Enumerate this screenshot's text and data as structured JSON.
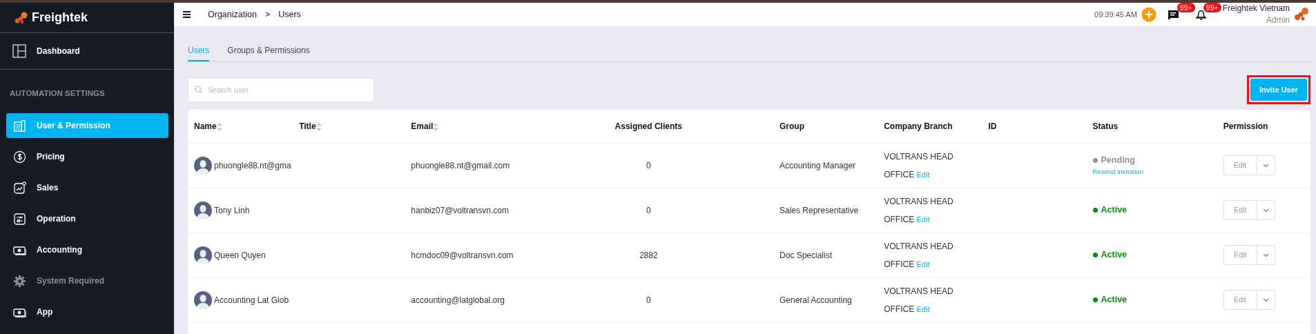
{
  "sidebar": {
    "brand": "Freightek",
    "top_item": {
      "label": "Dashboard"
    },
    "section": "AUTOMATION SETTINGS",
    "items": [
      {
        "label": "User & Permission",
        "selected": true,
        "disabled": false
      },
      {
        "label": "Pricing",
        "selected": false,
        "disabled": false
      },
      {
        "label": "Sales",
        "selected": false,
        "disabled": false
      },
      {
        "label": "Operation",
        "selected": false,
        "disabled": false
      },
      {
        "label": "Accounting",
        "selected": false,
        "disabled": false
      },
      {
        "label": "System Required",
        "selected": false,
        "disabled": true
      },
      {
        "label": "App",
        "selected": false,
        "disabled": false
      }
    ]
  },
  "topbar": {
    "breadcrumb": [
      "Organization",
      "Users"
    ],
    "separator": ">",
    "time": "09:39:45 AM",
    "messages_badge": "99+",
    "notifications_badge": "99+",
    "user_name": "Freightek Vietnam",
    "user_role": "Admin"
  },
  "tabs": [
    {
      "label": "Users",
      "selected": true
    },
    {
      "label": "Groups & Permissions",
      "selected": false
    }
  ],
  "search": {
    "placeholder": "Search user"
  },
  "invite_button": {
    "label": "Invite User",
    "highlighted": true
  },
  "table": {
    "columns": [
      {
        "label": "Name",
        "sortable": true
      },
      {
        "label": "Title",
        "sortable": true
      },
      {
        "label": "Email",
        "sortable": true
      },
      {
        "label": "Assigned Clients",
        "sortable": false
      },
      {
        "label": "Group",
        "sortable": false
      },
      {
        "label": "Company Branch",
        "sortable": false
      },
      {
        "label": "ID",
        "sortable": false
      },
      {
        "label": "Status",
        "sortable": false
      },
      {
        "label": "Permission",
        "sortable": false
      }
    ],
    "rows": [
      {
        "name": "phuongle88.nt@gma",
        "email": "phuongle88.nt@gmail.com",
        "assigned_clients": "0",
        "group": "Accounting Manager",
        "branch": "VOLTRANS HEAD OFFICE",
        "branch_link": "Edit",
        "status": {
          "kind": "pending",
          "label": "Pending",
          "action": "Resend Invitation"
        },
        "permission": "Edit"
      },
      {
        "name": "Tony Linh",
        "email": "hanbiz07@voltransvn.com",
        "assigned_clients": "0",
        "group": "Sales Representative",
        "branch": "VOLTRANS HEAD OFFICE",
        "branch_link": "Edit",
        "status": {
          "kind": "active",
          "label": "Active"
        },
        "permission": "Edit"
      },
      {
        "name": "Queen Quyen",
        "email": "hcmdoc09@voltransvn.com",
        "assigned_clients": "2882",
        "group": "Doc Specialist",
        "branch": "VOLTRANS HEAD OFFICE",
        "branch_link": "Edit",
        "status": {
          "kind": "active",
          "label": "Active"
        },
        "permission": "Edit"
      },
      {
        "name": "Accounting Lat Glob",
        "email": "accounting@latglobal.org",
        "assigned_clients": "0",
        "group": "General Accounting",
        "branch": "VOLTRANS HEAD OFFICE",
        "branch_link": "Edit",
        "status": {
          "kind": "active",
          "label": "Active"
        },
        "permission": "Edit"
      }
    ]
  }
}
